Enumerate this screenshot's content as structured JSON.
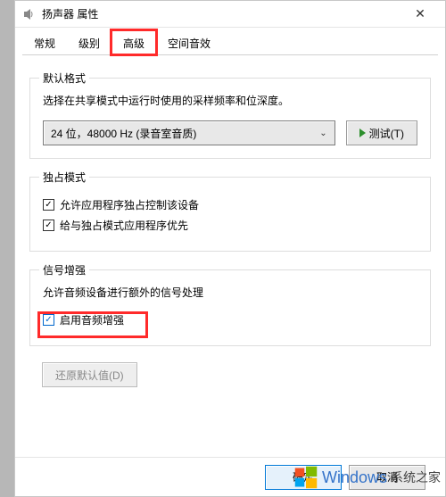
{
  "window": {
    "title": "扬声器 属性",
    "close_glyph": "✕"
  },
  "tabs": [
    {
      "label": "常规"
    },
    {
      "label": "级别"
    },
    {
      "label": "高级"
    },
    {
      "label": "空间音效"
    }
  ],
  "defaultFormat": {
    "title": "默认格式",
    "desc": "选择在共享模式中运行时使用的采样频率和位深度。",
    "selected": "24 位，48000 Hz (录音室音质)",
    "test_label": "测试(T)"
  },
  "exclusive": {
    "title": "独占模式",
    "opt1": "允许应用程序独占控制该设备",
    "opt2": "给与独占模式应用程序优先"
  },
  "enhance": {
    "title": "信号增强",
    "desc": "允许音频设备进行额外的信号处理",
    "opt1": "启用音频增强"
  },
  "restore_label": "还原默认值(D)",
  "footer": {
    "ok": "确定",
    "cancel": "取消"
  },
  "watermark": {
    "brand": "Windows",
    "rest": "系统之家"
  },
  "chevron_glyph": "⌄",
  "checkmark_glyph": "✓"
}
